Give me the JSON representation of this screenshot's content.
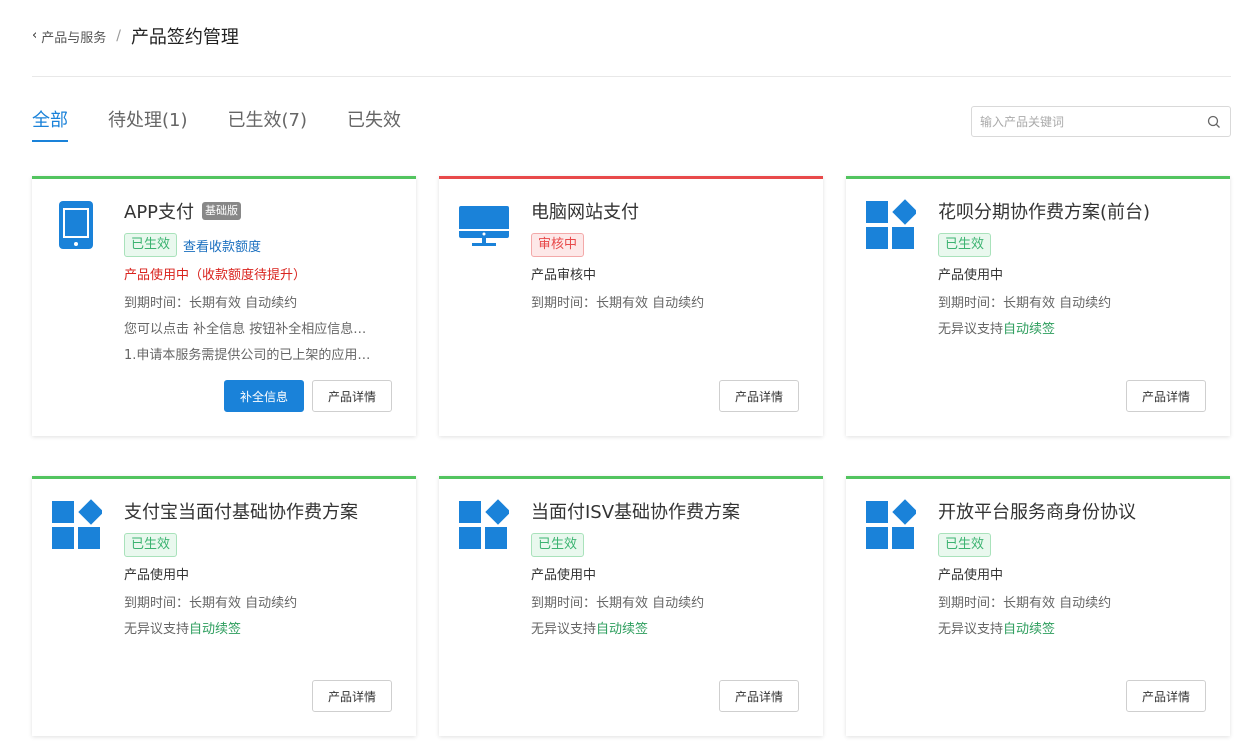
{
  "breadcrumb": {
    "back_label": "产品与服务",
    "separator": "/",
    "current": "产品签约管理"
  },
  "tabs": [
    {
      "label": "全部",
      "active": true
    },
    {
      "label": "待处理(1)",
      "active": false
    },
    {
      "label": "已生效(7)",
      "active": false
    },
    {
      "label": "已失效",
      "active": false
    }
  ],
  "search": {
    "placeholder": "输入产品关键词"
  },
  "colors": {
    "accent": "#1a82d9",
    "active_border": "#52c45f",
    "pending_border": "#e8494a"
  },
  "cards": [
    {
      "icon": "mobile-phone-icon",
      "title": "APP支付",
      "badge": "基础版",
      "status": "已生效",
      "link": "查看收款额度",
      "usage": "产品使用中（收款额度待提升）",
      "expire": "到期时间：长期有效 自动续约",
      "note1": "您可以点击 补全信息 按钮补全相应信息…",
      "note2": "1.申请本服务需提供公司的已上架的应用…",
      "primary_button": "补全信息",
      "detail_button": "产品详情"
    },
    {
      "icon": "desktop-monitor-icon",
      "title": "电脑网站支付",
      "status": "审核中",
      "usage": "产品审核中",
      "expire": "到期时间：长期有效 自动续约",
      "detail_button": "产品详情"
    },
    {
      "icon": "app-grid-icon",
      "title": "花呗分期协作费方案(前台)",
      "status": "已生效",
      "usage": "产品使用中",
      "expire": "到期时间：长期有效 自动续约",
      "renew_prefix": "无异议支持",
      "renew_link": "自动续签",
      "detail_button": "产品详情"
    },
    {
      "icon": "app-grid-icon",
      "title": "支付宝当面付基础协作费方案",
      "status": "已生效",
      "usage": "产品使用中",
      "expire": "到期时间：长期有效 自动续约",
      "renew_prefix": "无异议支持",
      "renew_link": "自动续签",
      "detail_button": "产品详情"
    },
    {
      "icon": "app-grid-icon",
      "title": "当面付ISV基础协作费方案",
      "status": "已生效",
      "usage": "产品使用中",
      "expire": "到期时间：长期有效 自动续约",
      "renew_prefix": "无异议支持",
      "renew_link": "自动续签",
      "detail_button": "产品详情"
    },
    {
      "icon": "app-grid-icon",
      "title": "开放平台服务商身份协议",
      "status": "已生效",
      "usage": "产品使用中",
      "expire": "到期时间：长期有效 自动续约",
      "renew_prefix": "无异议支持",
      "renew_link": "自动续签",
      "detail_button": "产品详情"
    }
  ]
}
